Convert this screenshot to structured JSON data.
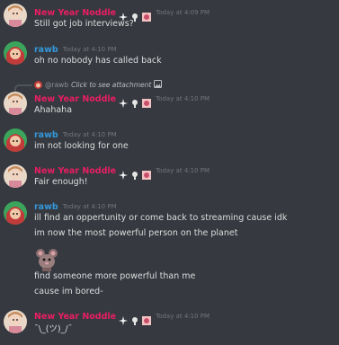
{
  "colors": {
    "background": "#36393f",
    "nny_name": "#e91e63",
    "rawb_name": "#3498db",
    "timestamp": "#72767d",
    "text": "#dcddde"
  },
  "badges": [
    "sparkle-badge",
    "trophy-badge",
    "flag-badge"
  ],
  "messages": [
    {
      "author": "New Year Noddle",
      "time": "Today at 4:09 PM",
      "lines": [
        "Still got job interviews?"
      ]
    },
    {
      "author": "rawb",
      "time": "Today at 4:10 PM",
      "lines": [
        "oh no nobody has called back"
      ]
    },
    {
      "reply": {
        "name": "@rawb",
        "text": "Click to see attachment"
      },
      "author": "New Year Noddle",
      "time": "Today at 4:10 PM",
      "lines": [
        "Ahahaha"
      ]
    },
    {
      "author": "rawb",
      "time": "Today at 4:10 PM",
      "lines": [
        "im not looking for one"
      ]
    },
    {
      "author": "New Year Noddle",
      "time": "Today at 4:10 PM",
      "lines": [
        "Fair enough!"
      ]
    },
    {
      "author": "rawb",
      "time": "Today at 4:10 PM",
      "lines": [
        "ill find an oppertunity or come back to streaming cause idk",
        "im now the most powerful person on the planet",
        "find someone more powerful than me",
        "cause im bored-"
      ]
    },
    {
      "author": "New Year Noddle",
      "time": "Today at 4:10 PM",
      "lines": [
        "¯\\_(ツ)_/¯"
      ]
    }
  ]
}
